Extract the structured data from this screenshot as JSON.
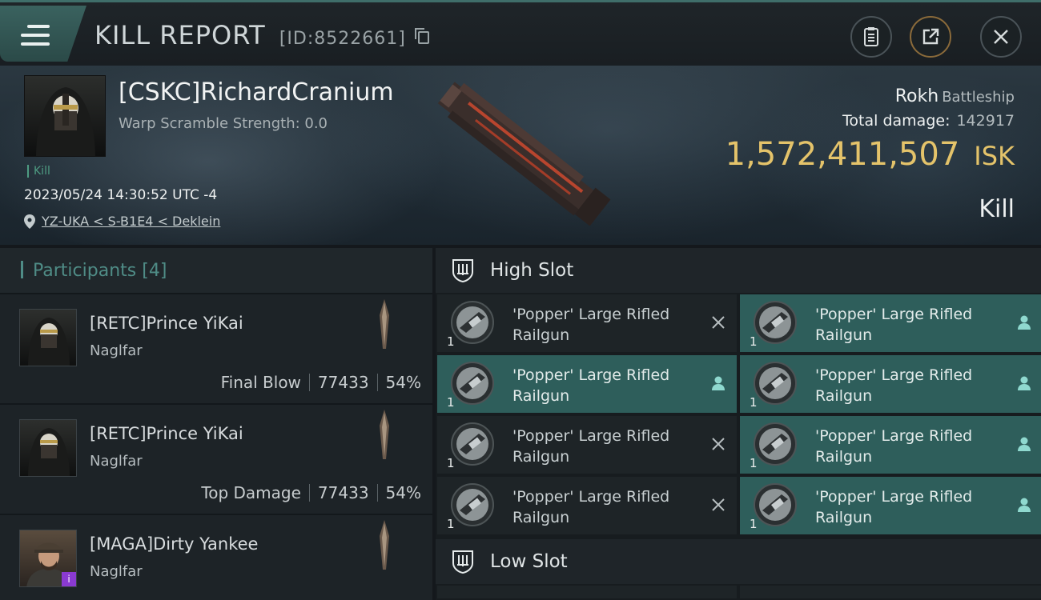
{
  "header": {
    "title": "KILL REPORT",
    "report_id": "[ID:8522661]",
    "menu_icon": "hamburger-menu-icon",
    "buttons": [
      "clipboard-icon",
      "share-icon",
      "close-icon"
    ]
  },
  "victim": {
    "name": "[CSKC]RichardCranium",
    "warp_scramble": "Warp Scramble Strength: 0.0",
    "tag": "Kill",
    "datetime": "2023/05/24 14:30:52 UTC -4",
    "location": "YZ-UKA < S-B1E4 < Deklein",
    "ship": "Rokh",
    "ship_class": "Battleship",
    "damage_label": "Total damage:",
    "damage_value": "142917",
    "isk_value": "1,572,411,507",
    "isk_unit": "ISK",
    "result": "Kill"
  },
  "participants": {
    "label": "Participants",
    "count": "[4]",
    "rows": [
      {
        "name": "[RETC]Prince YiKai",
        "ship": "Naglfar",
        "role": "Final Blow",
        "damage": "77433",
        "percent": "54%"
      },
      {
        "name": "[RETC]Prince YiKai",
        "ship": "Naglfar",
        "role": "Top Damage",
        "damage": "77433",
        "percent": "54%"
      },
      {
        "name": "[MAGA]Dirty Yankee",
        "ship": "Naglfar",
        "role": "",
        "damage": "",
        "percent": "",
        "badge": "i"
      }
    ]
  },
  "slots": {
    "high_label": "High Slot",
    "low_label": "Low Slot",
    "modules": [
      {
        "name": "'Popper' Large Rifled Railgun",
        "qty": "1",
        "status": "destroyed"
      },
      {
        "name": "'Popper' Large Rifled Railgun",
        "qty": "1",
        "status": "dropped"
      },
      {
        "name": "'Popper' Large Rifled Railgun",
        "qty": "1",
        "status": "dropped"
      },
      {
        "name": "'Popper' Large Rifled Railgun",
        "qty": "1",
        "status": "dropped"
      },
      {
        "name": "'Popper' Large Rifled Railgun",
        "qty": "1",
        "status": "destroyed"
      },
      {
        "name": "'Popper' Large Rifled Railgun",
        "qty": "1",
        "status": "dropped"
      },
      {
        "name": "'Popper' Large Rifled Railgun",
        "qty": "1",
        "status": "destroyed"
      },
      {
        "name": "'Popper' Large Rifled Railgun",
        "qty": "1",
        "status": "dropped"
      }
    ]
  },
  "colors": {
    "accent_teal": "#2e5e5b",
    "isk_gold": "#e4c36a",
    "participants_label": "#4f8c86"
  }
}
